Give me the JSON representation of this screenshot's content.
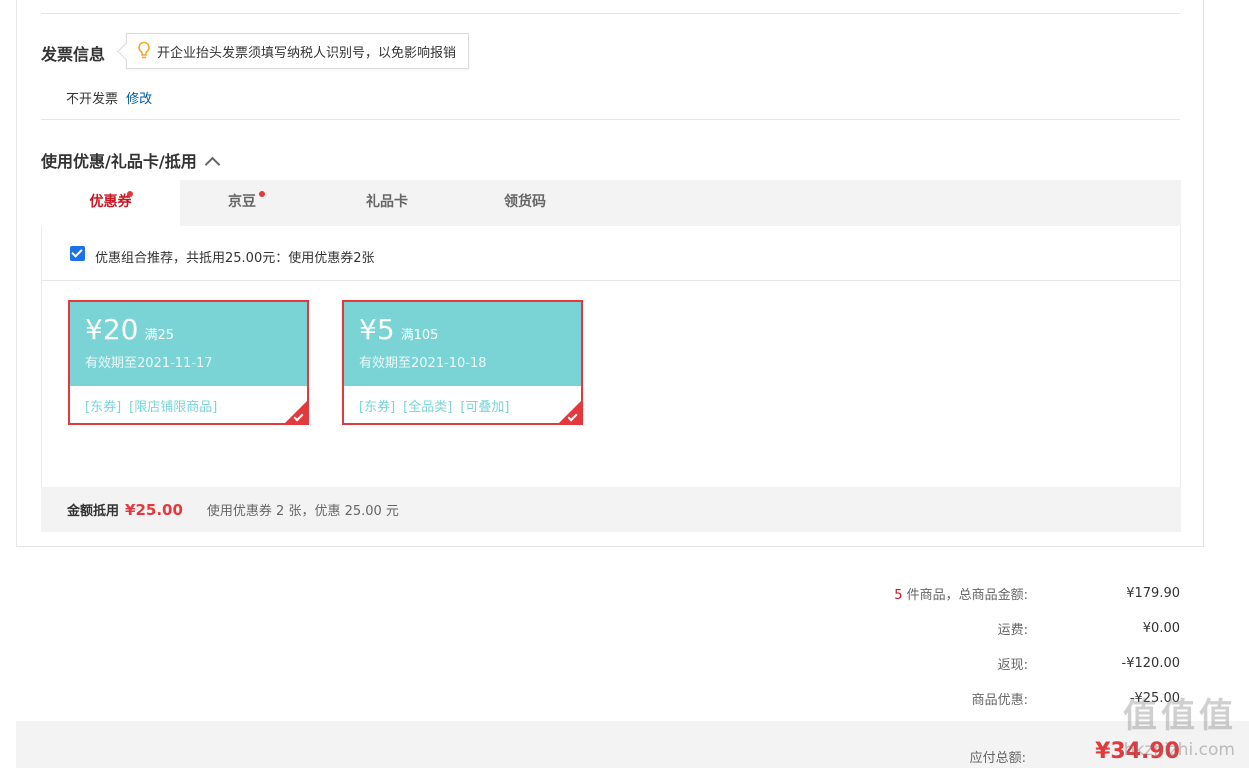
{
  "invoice": {
    "title": "发票信息",
    "tip": "开企业抬头发票须填写纳税人识别号，以免影响报销",
    "status": "不开发票",
    "edit_link": "修改"
  },
  "discount": {
    "title": "使用优惠/礼品卡/抵用",
    "tabs": [
      {
        "label": "优惠券",
        "active": true,
        "dot": true
      },
      {
        "label": "京豆",
        "active": false,
        "dot": true
      },
      {
        "label": "礼品卡",
        "active": false,
        "dot": false
      },
      {
        "label": "领货码",
        "active": false,
        "dot": false
      }
    ],
    "combo_checked": true,
    "combo_text": "优惠组合推荐，共抵用25.00元：使用优惠券2张",
    "coupons": [
      {
        "amount": "¥20",
        "condition": "满25",
        "expiry": "有效期至2021-11-17",
        "tags": [
          "[东券]",
          "[限店铺限商品]"
        ],
        "selected": true
      },
      {
        "amount": "¥5",
        "condition": "满105",
        "expiry": "有效期至2021-10-18",
        "tags": [
          "[东券]",
          "[全品类]",
          "[可叠加]"
        ],
        "selected": true
      }
    ],
    "summary": {
      "label": "金额抵用",
      "amount": "¥25.00",
      "desc": "使用优惠券 2 张，优惠 25.00 元"
    }
  },
  "totals": {
    "count": "5",
    "goods_label": " 件商品，总商品金额:",
    "goods_value": "¥179.90",
    "shipping_label": "运费:",
    "shipping_value": "¥0.00",
    "cashback_label": "返现:",
    "cashback_value": "-¥120.00",
    "promo_label": "商品优惠:",
    "promo_value": "-¥25.00",
    "payable_label": "应付总额:",
    "payable_value": "¥34.90"
  },
  "watermark": {
    "logo": "值值值",
    "url": "bkzhizhi.com"
  },
  "colors": {
    "accent": "#e4393c",
    "link": "#005aa0",
    "coupon": "#7ad4d6"
  }
}
